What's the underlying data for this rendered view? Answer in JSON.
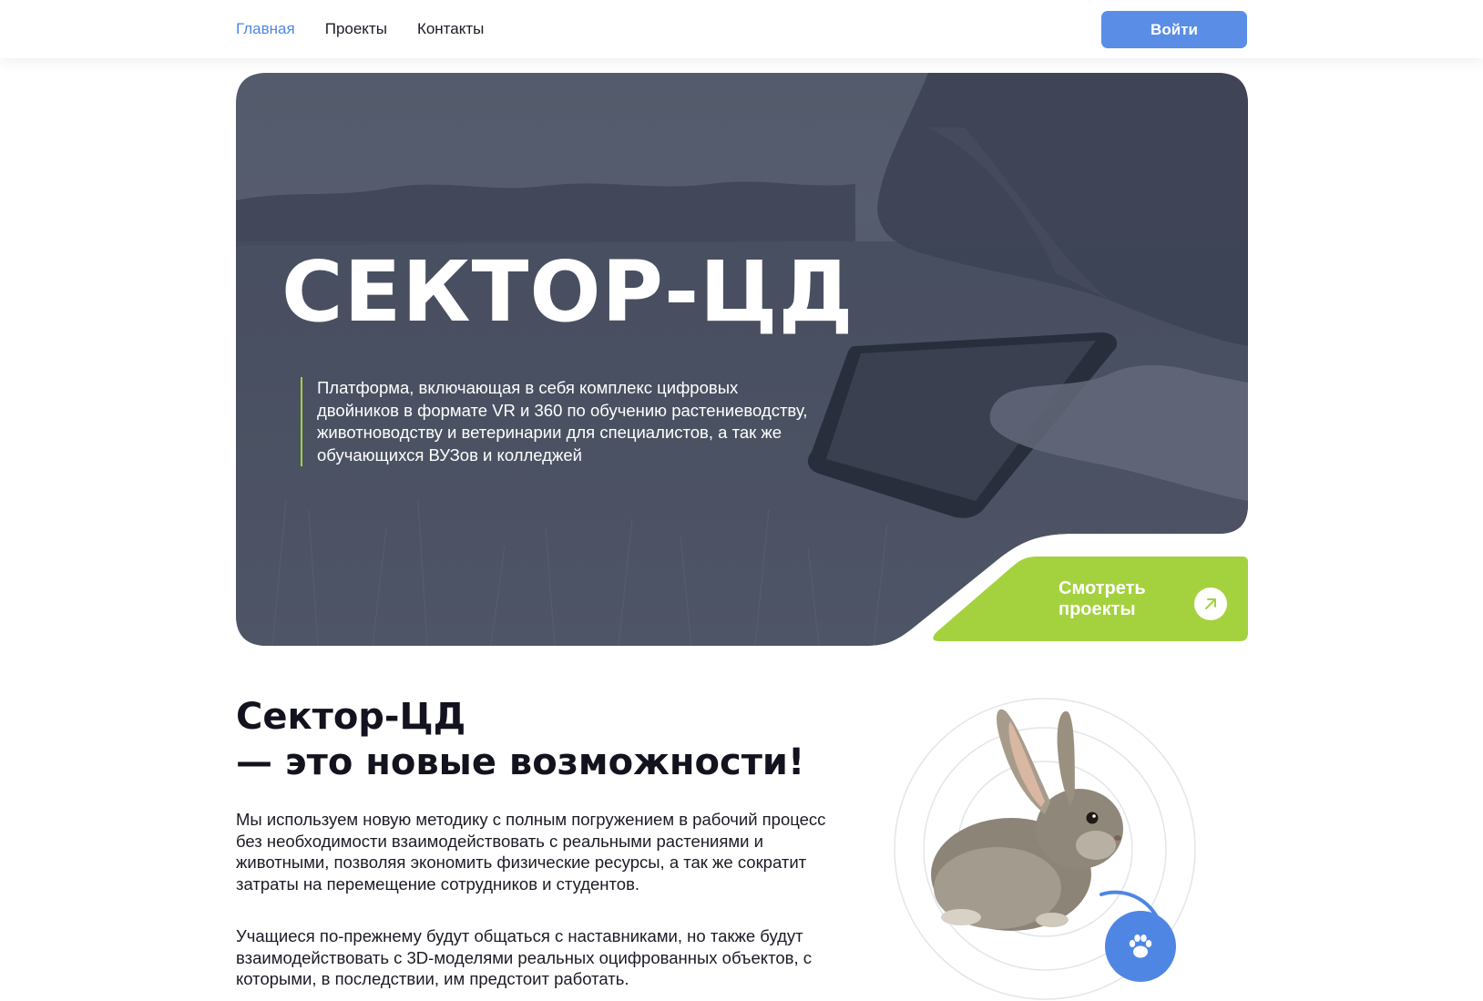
{
  "header": {
    "nav": [
      {
        "label": "Главная",
        "active": true
      },
      {
        "label": "Проекты",
        "active": false
      },
      {
        "label": "Контакты",
        "active": false
      }
    ],
    "login_label": "Войти"
  },
  "hero": {
    "title": "СЕКТОР-ЦД",
    "description": "Платформа, включающая в себя комплекс цифровых двойников в формате VR и 360 по обучению растениеводству, животноводству и ветеринарии для специалистов, а так же обучающихся ВУЗов и колледжей",
    "cta_label": "Смотреть проекты",
    "background_icon": "field-tablet-photo",
    "cta_icon": "arrow-up-right-icon"
  },
  "about": {
    "title_line1": "Сектор-ЦД",
    "title_line2": "— это новые возможности!",
    "paragraph1": "Мы используем новую методику с полным погружением в рабочий процесс без необходимости взаимодействовать с реальными растениями и животными, позволяя экономить физические ресурсы, а так же сократит затраты на перемещение сотрудников и студентов.",
    "paragraph2": "Учащиеся по-прежнему будут общаться с наставниками, но также будут взаимодействовать с 3D-моделями реальных оцифрованных объектов, с которыми, в последствии, им предстоит работать.",
    "image_icon": "rabbit-illustration",
    "badge_icon": "paw-icon"
  },
  "colors": {
    "accent_blue": "#5a8de6",
    "accent_green": "#a4d23e",
    "hero_overlay": "#525869",
    "text_dark": "#13131f"
  }
}
